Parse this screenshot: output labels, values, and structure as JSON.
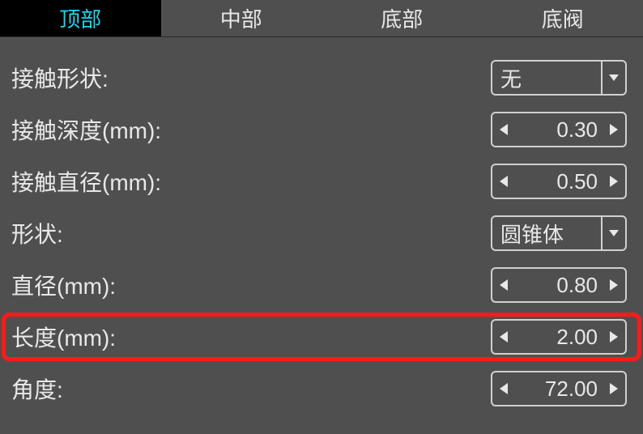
{
  "tabs": {
    "t0": "顶部",
    "t1": "中部",
    "t2": "底部",
    "t3": "底阀"
  },
  "rows": {
    "contact_shape": {
      "label": "接触形状:",
      "value": "无"
    },
    "contact_depth": {
      "label": "接触深度(mm):",
      "value": "0.30"
    },
    "contact_diameter": {
      "label": "接触直径(mm):",
      "value": "0.50"
    },
    "shape": {
      "label": "形状:",
      "value": "圆锥体"
    },
    "diameter": {
      "label": "直径(mm):",
      "value": "0.80"
    },
    "length": {
      "label": "长度(mm):",
      "value": "2.00"
    },
    "angle": {
      "label": "角度:",
      "value": "72.00"
    }
  }
}
